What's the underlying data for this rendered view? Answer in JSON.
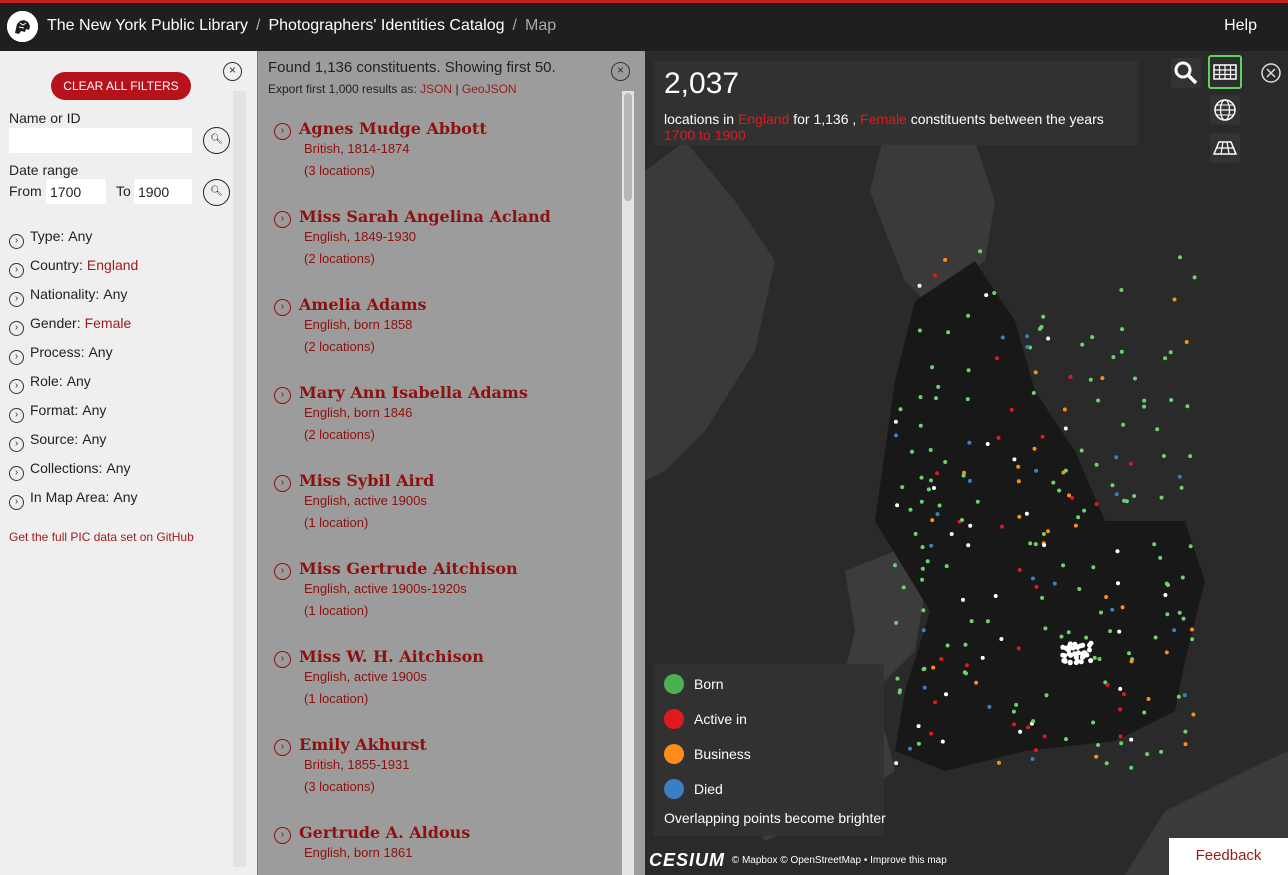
{
  "header": {
    "library": "The New York Public Library",
    "catalog": "Photographers' Identities Catalog",
    "current": "Map",
    "help": "Help"
  },
  "filters": {
    "clear_label": "CLEAR ALL FILTERS",
    "name_label": "Name or ID",
    "name_value": "",
    "date_label": "Date range",
    "from_label": "From",
    "from_value": "1700",
    "to_label": "To",
    "to_value": "1900",
    "items": [
      {
        "label": "Type:",
        "value": "Any",
        "highlight": false
      },
      {
        "label": "Country:",
        "value": "England",
        "highlight": true
      },
      {
        "label": "Nationality:",
        "value": "Any",
        "highlight": false
      },
      {
        "label": "Gender:",
        "value": "Female",
        "highlight": true
      },
      {
        "label": "Process:",
        "value": "Any",
        "highlight": false
      },
      {
        "label": "Role:",
        "value": "Any",
        "highlight": false
      },
      {
        "label": "Format:",
        "value": "Any",
        "highlight": false
      },
      {
        "label": "Source:",
        "value": "Any",
        "highlight": false
      },
      {
        "label": "Collections:",
        "value": "Any",
        "highlight": false
      },
      {
        "label": "In Map Area:",
        "value": "Any",
        "highlight": false
      }
    ],
    "github_link": "Get the full PIC data set on GitHub"
  },
  "results": {
    "found": "Found 1,136 constituents. Showing first 50.",
    "export_prefix": "Export first 1,000 results as:",
    "export_json": "JSON",
    "export_sep": "|",
    "export_geojson": "GeoJSON",
    "people": [
      {
        "name": "Agnes Mudge Abbott",
        "meta": "British, 1814-1874",
        "locations": "(3 locations)"
      },
      {
        "name": "Miss Sarah Angelina Acland",
        "meta": "English, 1849-1930",
        "locations": "(2 locations)"
      },
      {
        "name": "Amelia Adams",
        "meta": "English, born 1858",
        "locations": "(2 locations)"
      },
      {
        "name": "Mary Ann Isabella Adams",
        "meta": "English, born 1846",
        "locations": "(2 locations)"
      },
      {
        "name": "Miss Sybil Aird",
        "meta": "English, active 1900s",
        "locations": "(1 location)"
      },
      {
        "name": "Miss Gertrude Aitchison",
        "meta": "English, active 1900s-1920s",
        "locations": "(1 location)"
      },
      {
        "name": "Miss W. H. Aitchison",
        "meta": "English, active 1900s",
        "locations": "(1 location)"
      },
      {
        "name": "Emily Akhurst",
        "meta": "British, 1855-1931",
        "locations": "(3 locations)"
      },
      {
        "name": "Gertrude A. Aldous",
        "meta": "English, born 1861",
        "locations": ""
      }
    ]
  },
  "map": {
    "count": "2,037",
    "t1": "locations in",
    "country": "England",
    "t2": "for 1,136 ,",
    "gender": "Female",
    "t3": "constituents between the years",
    "years": "1700 to 1900",
    "legend": [
      {
        "label": "Born",
        "color": "#4caf50"
      },
      {
        "label": "Active in",
        "color": "#e0191f"
      },
      {
        "label": "Business",
        "color": "#ff8c1a"
      },
      {
        "label": "Died",
        "color": "#3a7fc4"
      }
    ],
    "legend_note": "Overlapping points become brighter",
    "cesium": "CESIUM",
    "attribution": "© Mapbox © OpenStreetMap • Improve this map",
    "feedback": "Feedback",
    "tools": [
      "search-icon",
      "grid-view-icon",
      "globe-icon",
      "flat-map-icon",
      "close-icon"
    ]
  }
}
